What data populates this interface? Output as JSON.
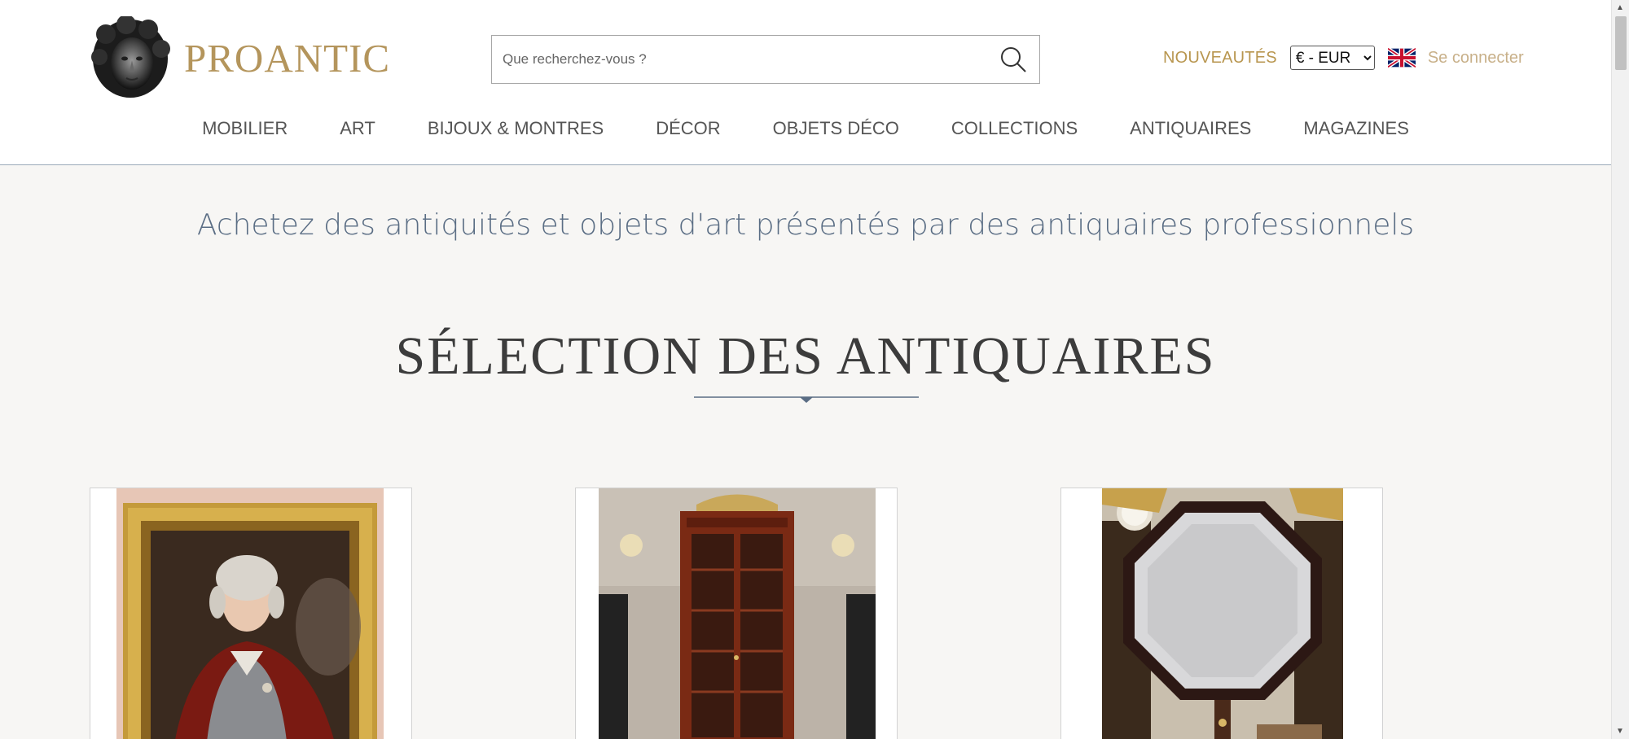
{
  "header": {
    "logo_text": "PROANTIC",
    "search_placeholder": "Que recherchez-vous ?",
    "nouveautes": "NOUVEAUTÉS",
    "currency_selected": "€ - EUR",
    "language_flag": "uk-flag-icon",
    "login": "Se connecter"
  },
  "nav": {
    "items": [
      "MOBILIER",
      "ART",
      "BIJOUX & MONTRES",
      "DÉCOR",
      "OBJETS DÉCO",
      "COLLECTIONS",
      "ANTIQUAIRES",
      "MAGAZINES"
    ]
  },
  "main": {
    "tagline": "Achetez des antiquités et objets d'art présentés par des antiquaires professionnels",
    "section_title": "SÉLECTION DES ANTIQUAIRES"
  },
  "colors": {
    "accent_gold": "#b4955c",
    "tagline_blue": "#5a6d84",
    "background": "#f7f6f4"
  }
}
